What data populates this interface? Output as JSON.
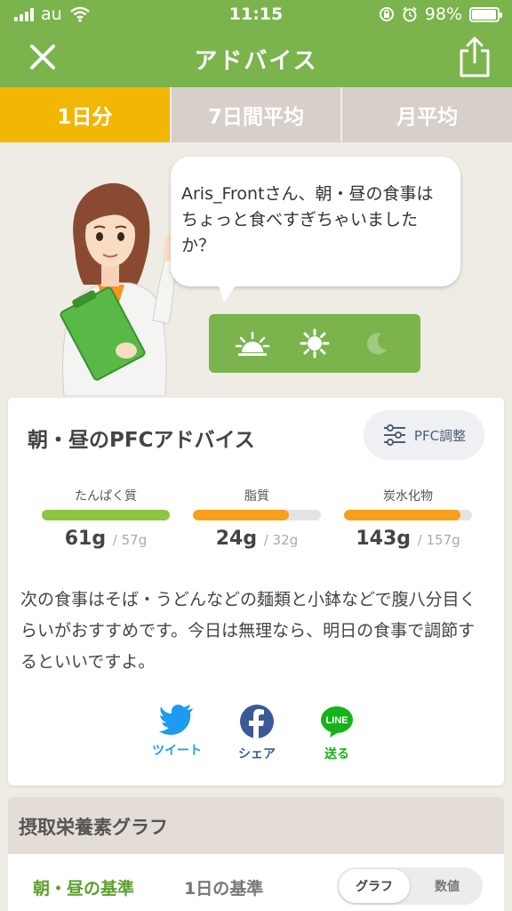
{
  "status_bar": {
    "carrier": "au",
    "time": "11:15",
    "battery": "98%",
    "battery_level": 0.98
  },
  "header": {
    "title": "アドバイス"
  },
  "tabs": [
    {
      "label": "1日分",
      "active": true
    },
    {
      "label": "7日間平均",
      "active": false
    },
    {
      "label": "月平均",
      "active": false
    }
  ],
  "advice_bubble": {
    "message": "Aris_Frontさん、朝・昼の食事はちょっと食べすぎちゃいましたか？"
  },
  "meals": [
    {
      "icon": "sunrise-icon",
      "active": true
    },
    {
      "icon": "sun-icon",
      "active": true
    },
    {
      "icon": "moon-icon",
      "active": false
    }
  ],
  "pfc_card": {
    "title": "朝・昼のPFCアドバイス",
    "adjust_label": "PFC調整",
    "nutrients": [
      {
        "name": "たんぱく質",
        "value": "61g",
        "target": "/ 57g",
        "ratio": 1.0,
        "color": "#8cc63f"
      },
      {
        "name": "脂質",
        "value": "24g",
        "target": "/ 32g",
        "ratio": 0.75,
        "color": "#f7a01c"
      },
      {
        "name": "炭水化物",
        "value": "143g",
        "target": "/ 157g",
        "ratio": 0.91,
        "color": "#f7a01c"
      }
    ],
    "advice": "次の食事はそば・うどんなどの麺類と小鉢などで腹八分目くらいがおすすめです。今日は無理なら、明日の食事で調節するといいですよ。"
  },
  "share": [
    {
      "label": "ツイート",
      "color": "#1d9bf0",
      "icon": "twitter-icon"
    },
    {
      "label": "シェア",
      "color": "#3b5998",
      "icon": "facebook-icon"
    },
    {
      "label": "送る",
      "color": "#16b21a",
      "icon": "line-icon"
    }
  ],
  "graph_card": {
    "title": "摂取栄養素グラフ",
    "option_meal": "朝・昼の基準",
    "option_day": "1日の基準",
    "toggle_graph": "グラフ",
    "toggle_numbers": "数値"
  },
  "colors": {
    "brand_green": "#7bb34c",
    "tab_active": "#f2b705",
    "tab_inactive": "#d7cfca"
  }
}
